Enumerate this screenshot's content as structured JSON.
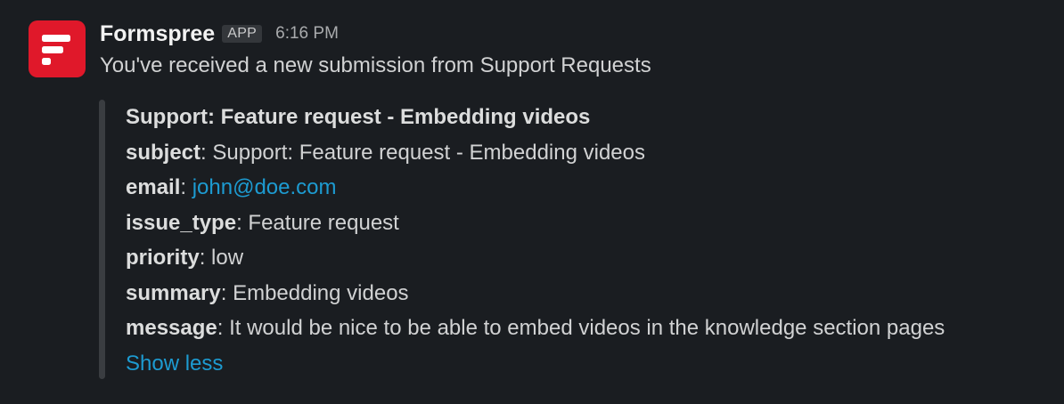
{
  "message": {
    "sender": "Formspree",
    "badge": "APP",
    "time": "6:16 PM",
    "text": "You've received a new submission from Support Requests"
  },
  "attachment": {
    "title": "Support: Feature request - Embedding videos",
    "fields": [
      {
        "key": "subject",
        "value": "Support: Feature request - Embedding videos"
      },
      {
        "key": "email",
        "value": "john@doe.com"
      },
      {
        "key": "issue_type",
        "value": "Feature request"
      },
      {
        "key": "priority",
        "value": "low"
      },
      {
        "key": "summary",
        "value": "Embedding videos"
      },
      {
        "key": "message",
        "value": "It would be nice to be able to embed videos in the knowledge section pages"
      }
    ],
    "toggle_label": "Show less"
  },
  "colors": {
    "background": "#1a1d21",
    "brand": "#e0182a",
    "link": "#1d9bd1",
    "text": "#d1d2d3"
  },
  "icons": {
    "avatar": "formspree-logo-icon"
  }
}
